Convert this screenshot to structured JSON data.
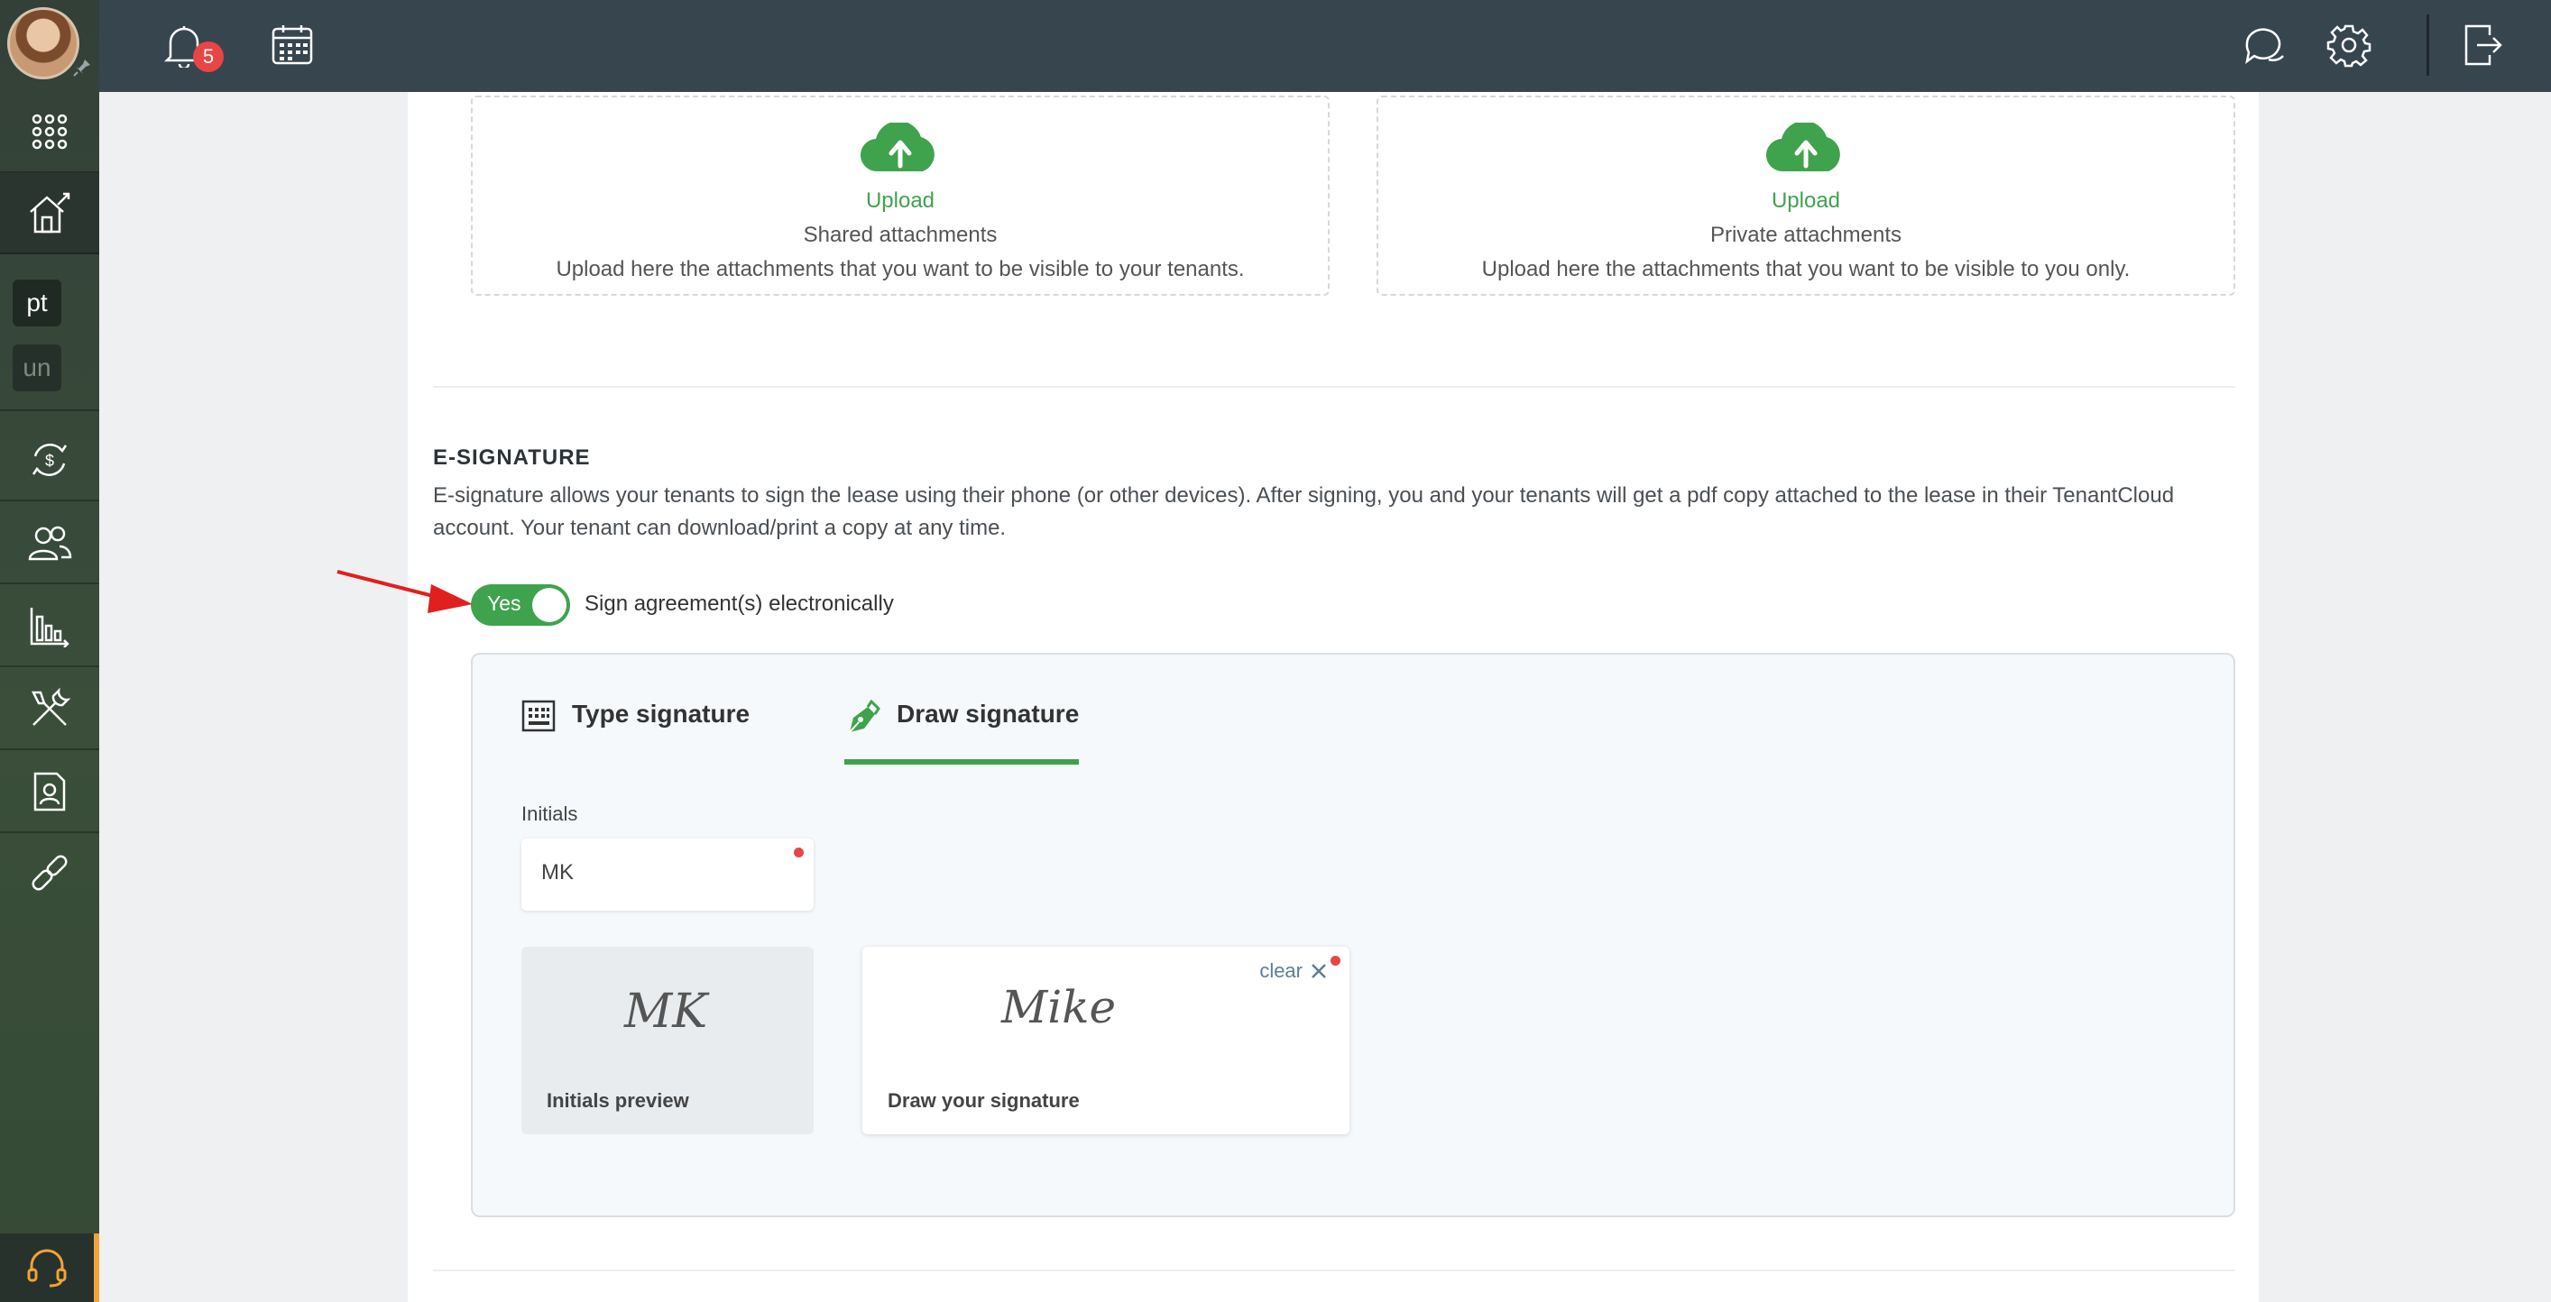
{
  "topbar": {
    "notifications_count": "5",
    "icons": [
      "bell-icon",
      "calendar-icon",
      "chat-icon",
      "gear-icon",
      "logout-icon"
    ]
  },
  "sidebar": {
    "items": [
      {
        "icon": "apps-grid-icon"
      },
      {
        "icon": "properties-icon",
        "active": true
      },
      {
        "label": "pt"
      },
      {
        "label": "un"
      },
      {
        "icon": "payments-icon"
      },
      {
        "icon": "people-icon"
      },
      {
        "icon": "reports-icon"
      },
      {
        "icon": "maintenance-icon"
      },
      {
        "icon": "contact-card-icon"
      },
      {
        "icon": "link-icon"
      }
    ],
    "support_icon": "headset-icon"
  },
  "attachments": {
    "shared": {
      "title": "Upload",
      "subtitle": "Shared attachments",
      "description": "Upload here the attachments that you want to be visible to your tenants."
    },
    "private": {
      "title": "Upload",
      "subtitle": "Private attachments",
      "description": "Upload here the attachments that you want to be visible to you only."
    }
  },
  "esignature": {
    "heading": "E-SIGNATURE",
    "description": "E-signature allows your tenants to sign the lease using their phone (or other devices). After signing, you and your tenants will get a pdf copy attached to the lease in their TenantCloud account. Your tenant can download/print a copy at any time.",
    "toggle_label": "Yes",
    "toggle_on": true,
    "toggle_text": "Sign agreement(s) electronically",
    "tabs": {
      "type_label": "Type signature",
      "draw_label": "Draw signature",
      "active": "draw"
    },
    "initials_label": "Initials",
    "initials_value": "MK",
    "initials_preview_script": "MK",
    "initials_preview_caption": "Initials preview",
    "signature_script": "Mike",
    "draw_caption": "Draw your signature",
    "clear_label": "clear"
  },
  "colors": {
    "accent": "#3fa34d",
    "topbar": "#37454f",
    "required_dot": "#e84545",
    "annotation_arrow": "#e0201f"
  }
}
